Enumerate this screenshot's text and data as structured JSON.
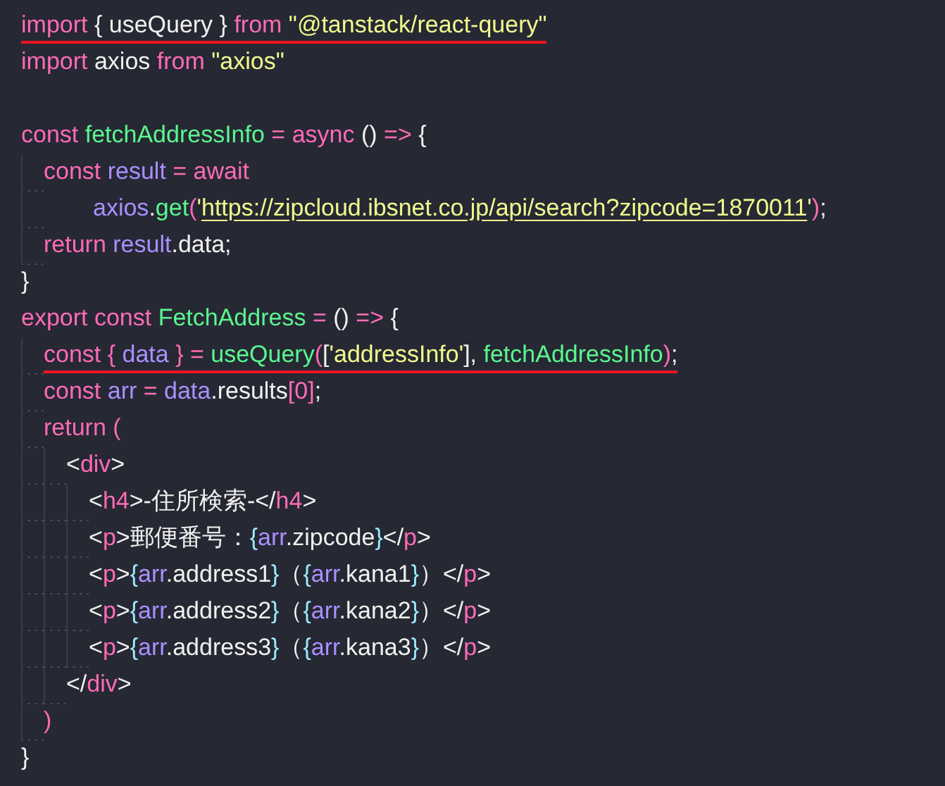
{
  "lines": [
    {
      "kind": "code",
      "underlined": true,
      "tokens": [
        {
          "kind": "keyword",
          "text": "import"
        },
        {
          "kind": "plain",
          "text": " { useQuery } "
        },
        {
          "kind": "keyword",
          "text": "from "
        },
        {
          "kind": "string",
          "text": "\"@tanstack/react-query\""
        }
      ]
    },
    {
      "kind": "code",
      "underlined": false,
      "tokens": [
        {
          "kind": "keyword",
          "text": "import"
        },
        {
          "kind": "plain",
          "text": " axios "
        },
        {
          "kind": "keyword",
          "text": "from "
        },
        {
          "kind": "string",
          "text": "\"axios\""
        }
      ]
    },
    {
      "kind": "blank"
    },
    {
      "kind": "code",
      "underlined": false,
      "tokens": [
        {
          "kind": "keyword",
          "text": "const "
        },
        {
          "kind": "function",
          "text": "fetchAddressInfo "
        },
        {
          "kind": "keyword",
          "text": "= async"
        },
        {
          "kind": "plain",
          "text": " () "
        },
        {
          "kind": "keyword",
          "text": "=>"
        },
        {
          "kind": "plain",
          "text": " {"
        }
      ],
      "children": [
        {
          "kind": "code",
          "underlined": false,
          "tokens": [
            {
              "kind": "keyword",
              "text": "const "
            },
            {
              "kind": "variable",
              "text": "result "
            },
            {
              "kind": "keyword",
              "text": "= await"
            }
          ],
          "children": [
            {
              "kind": "wrap",
              "underlined": false,
              "tokens": [
                {
                  "kind": "variable",
                  "text": "axios"
                },
                {
                  "kind": "plain",
                  "text": "."
                },
                {
                  "kind": "function",
                  "text": "get"
                },
                {
                  "kind": "keyword",
                  "text": "("
                },
                {
                  "kind": "string",
                  "text": "'"
                },
                {
                  "kind": "link",
                  "text": "https://zipcloud.ibsnet.co.jp/api/search?zipcode=1870011"
                },
                {
                  "kind": "string",
                  "text": "'"
                },
                {
                  "kind": "keyword",
                  "text": ")"
                },
                {
                  "kind": "plain",
                  "text": ";"
                }
              ]
            }
          ]
        },
        {
          "kind": "code",
          "underlined": false,
          "tokens": [
            {
              "kind": "keyword",
              "text": "return "
            },
            {
              "kind": "variable",
              "text": "result"
            },
            {
              "kind": "plain",
              "text": ".data;"
            }
          ]
        }
      ]
    },
    {
      "kind": "code",
      "underlined": false,
      "tokens": [
        {
          "kind": "plain",
          "text": "}"
        }
      ]
    },
    {
      "kind": "code",
      "underlined": false,
      "tokens": [
        {
          "kind": "keyword",
          "text": "export const "
        },
        {
          "kind": "function",
          "text": "FetchAddress "
        },
        {
          "kind": "keyword",
          "text": "="
        },
        {
          "kind": "plain",
          "text": " () "
        },
        {
          "kind": "keyword",
          "text": "=>"
        },
        {
          "kind": "plain",
          "text": " {"
        }
      ],
      "children": [
        {
          "kind": "code",
          "underlined": true,
          "tokens": [
            {
              "kind": "keyword",
              "text": "const { "
            },
            {
              "kind": "variable",
              "text": "data "
            },
            {
              "kind": "keyword",
              "text": "} = "
            },
            {
              "kind": "function",
              "text": "useQuery"
            },
            {
              "kind": "keyword",
              "text": "("
            },
            {
              "kind": "plain",
              "text": "["
            },
            {
              "kind": "string",
              "text": "'addressInfo'"
            },
            {
              "kind": "plain",
              "text": "], "
            },
            {
              "kind": "function",
              "text": "fetchAddressInfo"
            },
            {
              "kind": "keyword",
              "text": ")"
            },
            {
              "kind": "plain",
              "text": ";"
            }
          ]
        },
        {
          "kind": "code",
          "underlined": false,
          "tokens": [
            {
              "kind": "keyword",
              "text": "const "
            },
            {
              "kind": "variable",
              "text": "arr "
            },
            {
              "kind": "keyword",
              "text": "= "
            },
            {
              "kind": "variable",
              "text": "data"
            },
            {
              "kind": "plain",
              "text": ".results"
            },
            {
              "kind": "keyword",
              "text": "[0]"
            },
            {
              "kind": "plain",
              "text": ";"
            }
          ]
        },
        {
          "kind": "code",
          "underlined": false,
          "tokens": [
            {
              "kind": "keyword",
              "text": "return ("
            }
          ],
          "children": [
            {
              "kind": "code",
              "underlined": false,
              "tokens": [
                {
                  "kind": "plain",
                  "text": "<"
                },
                {
                  "kind": "keyword",
                  "text": "div"
                },
                {
                  "kind": "plain",
                  "text": ">"
                }
              ],
              "children": [
                {
                  "kind": "code",
                  "underlined": false,
                  "tokens": [
                    {
                      "kind": "plain",
                      "text": "<"
                    },
                    {
                      "kind": "keyword",
                      "text": "h4"
                    },
                    {
                      "kind": "plain",
                      "text": ">-住所検索-</"
                    },
                    {
                      "kind": "keyword",
                      "text": "h4"
                    },
                    {
                      "kind": "plain",
                      "text": ">"
                    }
                  ]
                },
                {
                  "kind": "code",
                  "underlined": false,
                  "tokens": [
                    {
                      "kind": "plain",
                      "text": "<"
                    },
                    {
                      "kind": "keyword",
                      "text": "p"
                    },
                    {
                      "kind": "plain",
                      "text": ">郵便番号："
                    },
                    {
                      "kind": "brace",
                      "text": "{"
                    },
                    {
                      "kind": "variable",
                      "text": "arr"
                    },
                    {
                      "kind": "plain",
                      "text": ".zipcode"
                    },
                    {
                      "kind": "brace",
                      "text": "}"
                    },
                    {
                      "kind": "plain",
                      "text": "</"
                    },
                    {
                      "kind": "keyword",
                      "text": "p"
                    },
                    {
                      "kind": "plain",
                      "text": ">"
                    }
                  ]
                },
                {
                  "kind": "code",
                  "underlined": false,
                  "tokens": [
                    {
                      "kind": "plain",
                      "text": "<"
                    },
                    {
                      "kind": "keyword",
                      "text": "p"
                    },
                    {
                      "kind": "plain",
                      "text": ">"
                    },
                    {
                      "kind": "brace",
                      "text": "{"
                    },
                    {
                      "kind": "variable",
                      "text": "arr"
                    },
                    {
                      "kind": "plain",
                      "text": ".address1"
                    },
                    {
                      "kind": "brace",
                      "text": "}"
                    },
                    {
                      "kind": "plain",
                      "text": "（"
                    },
                    {
                      "kind": "brace",
                      "text": "{"
                    },
                    {
                      "kind": "variable",
                      "text": "arr"
                    },
                    {
                      "kind": "plain",
                      "text": ".kana1"
                    },
                    {
                      "kind": "brace",
                      "text": "}"
                    },
                    {
                      "kind": "plain",
                      "text": "）</"
                    },
                    {
                      "kind": "keyword",
                      "text": "p"
                    },
                    {
                      "kind": "plain",
                      "text": ">"
                    }
                  ]
                },
                {
                  "kind": "code",
                  "underlined": false,
                  "tokens": [
                    {
                      "kind": "plain",
                      "text": "<"
                    },
                    {
                      "kind": "keyword",
                      "text": "p"
                    },
                    {
                      "kind": "plain",
                      "text": ">"
                    },
                    {
                      "kind": "brace",
                      "text": "{"
                    },
                    {
                      "kind": "variable",
                      "text": "arr"
                    },
                    {
                      "kind": "plain",
                      "text": ".address2"
                    },
                    {
                      "kind": "brace",
                      "text": "}"
                    },
                    {
                      "kind": "plain",
                      "text": "（"
                    },
                    {
                      "kind": "brace",
                      "text": "{"
                    },
                    {
                      "kind": "variable",
                      "text": "arr"
                    },
                    {
                      "kind": "plain",
                      "text": ".kana2"
                    },
                    {
                      "kind": "brace",
                      "text": "}"
                    },
                    {
                      "kind": "plain",
                      "text": "）</"
                    },
                    {
                      "kind": "keyword",
                      "text": "p"
                    },
                    {
                      "kind": "plain",
                      "text": ">"
                    }
                  ]
                },
                {
                  "kind": "code",
                  "underlined": false,
                  "tokens": [
                    {
                      "kind": "plain",
                      "text": "<"
                    },
                    {
                      "kind": "keyword",
                      "text": "p"
                    },
                    {
                      "kind": "plain",
                      "text": ">"
                    },
                    {
                      "kind": "brace",
                      "text": "{"
                    },
                    {
                      "kind": "variable",
                      "text": "arr"
                    },
                    {
                      "kind": "plain",
                      "text": ".address3"
                    },
                    {
                      "kind": "brace",
                      "text": "}"
                    },
                    {
                      "kind": "plain",
                      "text": "（"
                    },
                    {
                      "kind": "brace",
                      "text": "{"
                    },
                    {
                      "kind": "variable",
                      "text": "arr"
                    },
                    {
                      "kind": "plain",
                      "text": ".kana3"
                    },
                    {
                      "kind": "brace",
                      "text": "}"
                    },
                    {
                      "kind": "plain",
                      "text": "）</"
                    },
                    {
                      "kind": "keyword",
                      "text": "p"
                    },
                    {
                      "kind": "plain",
                      "text": ">"
                    }
                  ]
                }
              ]
            },
            {
              "kind": "code",
              "underlined": false,
              "tokens": [
                {
                  "kind": "plain",
                  "text": "</"
                },
                {
                  "kind": "keyword",
                  "text": "div"
                },
                {
                  "kind": "plain",
                  "text": ">"
                }
              ]
            }
          ]
        },
        {
          "kind": "code",
          "underlined": false,
          "tokens": [
            {
              "kind": "keyword",
              "text": ")"
            }
          ]
        }
      ]
    },
    {
      "kind": "code",
      "underlined": false,
      "tokens": [
        {
          "kind": "plain",
          "text": "}"
        }
      ]
    }
  ]
}
